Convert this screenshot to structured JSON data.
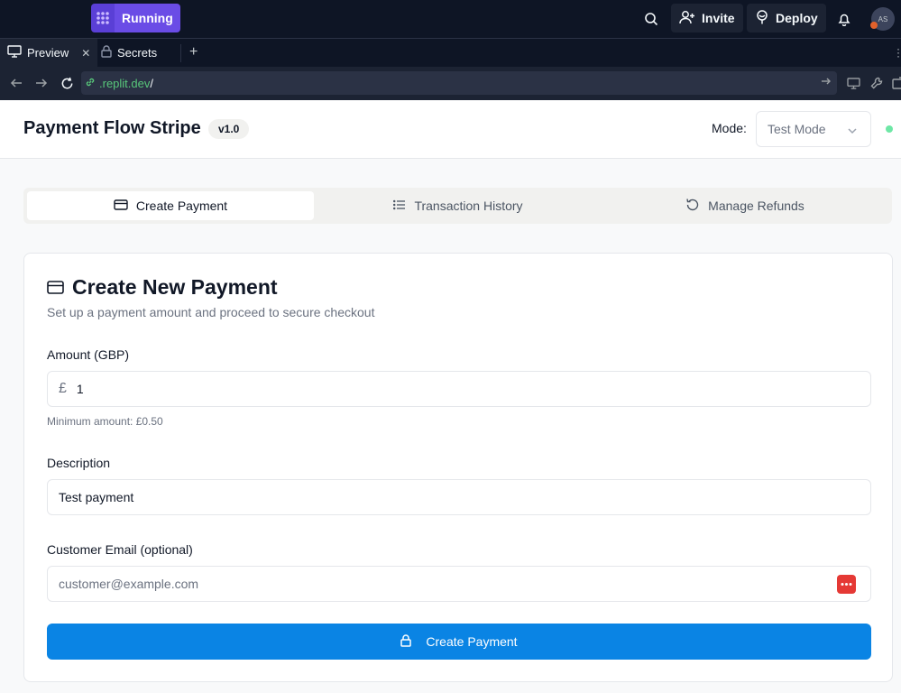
{
  "replit": {
    "run_label": "Running",
    "invite_label": "Invite",
    "deploy_label": "Deploy",
    "avatar_initials": "AS"
  },
  "tabs": [
    {
      "label": "Preview"
    },
    {
      "label": "Secrets"
    }
  ],
  "url": {
    "host": ".replit.dev",
    "path": "/"
  },
  "header": {
    "title": "Payment Flow Stripe",
    "version": "v1.0",
    "mode_label": "Mode:",
    "mode_value": "Test Mode"
  },
  "nav_tabs": [
    {
      "label": "Create Payment",
      "icon": "credit-card-icon",
      "active": true
    },
    {
      "label": "Transaction History",
      "icon": "list-icon",
      "active": false
    },
    {
      "label": "Manage Refunds",
      "icon": "rotate-ccw-icon",
      "active": false
    }
  ],
  "card": {
    "title": "Create New Payment",
    "subtitle": "Set up a payment amount and proceed to secure checkout",
    "amount_label": "Amount (GBP)",
    "currency_symbol": "£",
    "amount_value": "1",
    "amount_hint": "Minimum amount: £0.50",
    "description_label": "Description",
    "description_value": "Test payment",
    "email_label": "Customer Email (optional)",
    "email_placeholder": "customer@example.com",
    "submit_label": "Create Payment"
  },
  "colors": {
    "replit_bg": "#0e1525",
    "run_purple": "#6a4ce6",
    "primary_blue": "#0a84e4",
    "status_green": "#6ee7a6"
  }
}
